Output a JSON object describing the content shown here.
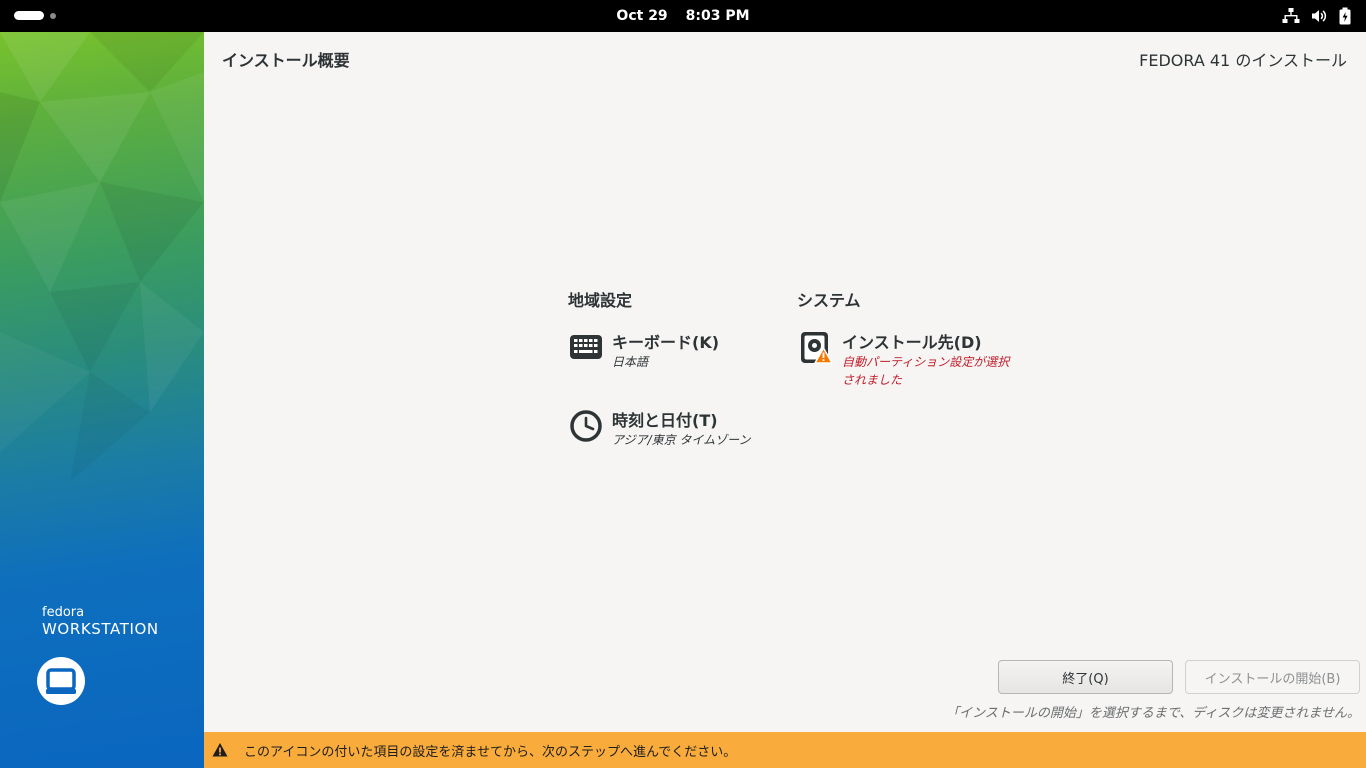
{
  "topbar": {
    "date": "Oct 29",
    "time": "8:03 PM",
    "tray_icons": [
      "network-icon",
      "volume-icon",
      "battery-icon"
    ]
  },
  "sidebar": {
    "brand_small": "fedora",
    "brand_big": "WORKSTATION",
    "logo_icon": "workstation-laptop-icon"
  },
  "header": {
    "page_title": "インストール概要",
    "product_title": "FEDORA 41 のインストール"
  },
  "sections": {
    "localization": {
      "title": "地域設定",
      "keyboard": {
        "title": "キーボード(K)",
        "status": "日本語"
      },
      "datetime": {
        "title": "時刻と日付(T)",
        "status": "アジア/東京 タイムゾーン"
      }
    },
    "system": {
      "title": "システム",
      "destination": {
        "title": "インストール先(D)",
        "status": "自動パーティション設定が選択されました"
      }
    }
  },
  "buttons": {
    "quit": "終了(Q)",
    "begin": "インストールの開始(B)"
  },
  "footnote": "「インストールの開始」を選択するまで、ディスクは変更されません。",
  "warning_bar": {
    "text": "このアイコンの付いた項目の設定を済ませてから、次のステップへ進んでください。"
  },
  "colors": {
    "warning_bar": "#f9ab3b",
    "warning_text": "#c01c28",
    "sidebar_top": "#79c22c",
    "sidebar_bottom": "#0a66bf"
  }
}
